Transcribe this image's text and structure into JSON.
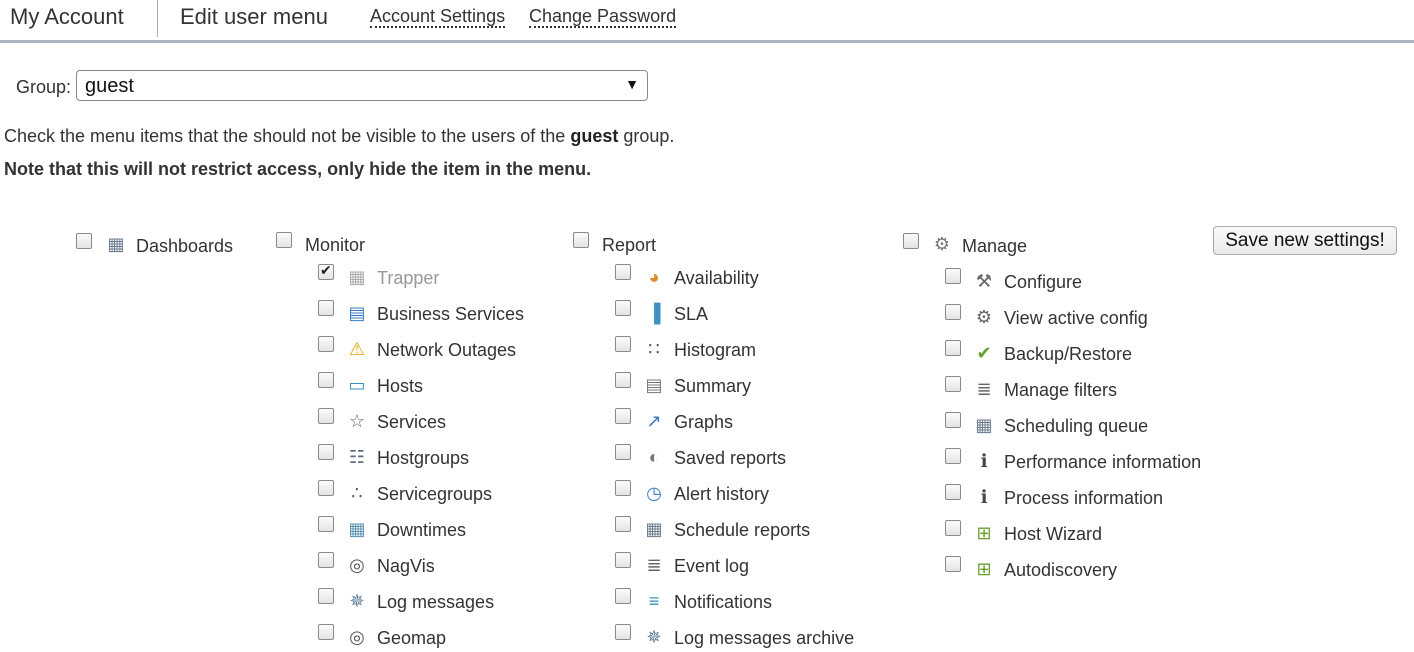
{
  "header": {
    "title": "My Account",
    "subtitle": "Edit user menu",
    "links": [
      "Account Settings",
      "Change Password"
    ]
  },
  "group": {
    "label": "Group:",
    "selected": "guest"
  },
  "info": {
    "pre": "Check the menu items that the should not be visible to the users of the ",
    "group": "guest",
    "post": " group.",
    "note": "Note that this will not restrict access, only hide the item in the menu."
  },
  "save_label": "Save new settings!",
  "sections": [
    {
      "label": "Dashboards",
      "icon": "dashboard-icon",
      "items": []
    },
    {
      "label": "Monitor",
      "icon": "",
      "items": [
        {
          "label": "Trapper",
          "icon": "trapper-icon",
          "checked": true
        },
        {
          "label": "Business Services",
          "icon": "business-services-icon",
          "checked": false
        },
        {
          "label": "Network Outages",
          "icon": "warning-icon",
          "checked": false
        },
        {
          "label": "Hosts",
          "icon": "monitor-icon",
          "checked": false
        },
        {
          "label": "Services",
          "icon": "star-icon",
          "checked": false
        },
        {
          "label": "Hostgroups",
          "icon": "hierarchy-icon",
          "checked": false
        },
        {
          "label": "Servicegroups",
          "icon": "servicegroup-icon",
          "checked": false
        },
        {
          "label": "Downtimes",
          "icon": "downtime-calendar-icon",
          "checked": false
        },
        {
          "label": "NagVis",
          "icon": "globe-icon",
          "checked": false
        },
        {
          "label": "Log messages",
          "icon": "log-icon",
          "checked": false
        },
        {
          "label": "Geomap",
          "icon": "globe-icon",
          "checked": false
        }
      ]
    },
    {
      "label": "Report",
      "icon": "",
      "items": [
        {
          "label": "Availability",
          "icon": "pie-chart-icon",
          "checked": false
        },
        {
          "label": "SLA",
          "icon": "bar-chart-icon",
          "checked": false
        },
        {
          "label": "Histogram",
          "icon": "histogram-icon",
          "checked": false
        },
        {
          "label": "Summary",
          "icon": "summary-icon",
          "checked": false
        },
        {
          "label": "Graphs",
          "icon": "line-graph-icon",
          "checked": false
        },
        {
          "label": "Saved reports",
          "icon": "saved-reports-icon",
          "checked": false
        },
        {
          "label": "Alert history",
          "icon": "alert-history-icon",
          "checked": false
        },
        {
          "label": "Schedule reports",
          "icon": "calendar-icon",
          "checked": false
        },
        {
          "label": "Event log",
          "icon": "document-icon",
          "checked": false
        },
        {
          "label": "Notifications",
          "icon": "notification-icon",
          "checked": false
        },
        {
          "label": "Log messages archive",
          "icon": "log-icon",
          "checked": false
        }
      ]
    },
    {
      "label": "Manage",
      "icon": "gear-icon",
      "items": [
        {
          "label": "Configure",
          "icon": "wrench-icon",
          "checked": false
        },
        {
          "label": "View active config",
          "icon": "gear-magnifier-icon",
          "checked": false
        },
        {
          "label": "Backup/Restore",
          "icon": "backup-icon",
          "checked": false
        },
        {
          "label": "Manage filters",
          "icon": "document-icon",
          "checked": false
        },
        {
          "label": "Scheduling queue",
          "icon": "calendar-icon",
          "checked": false
        },
        {
          "label": "Performance information",
          "icon": "info-icon",
          "checked": false
        },
        {
          "label": "Process information",
          "icon": "info-icon",
          "checked": false
        },
        {
          "label": "Host Wizard",
          "icon": "add-monitor-icon",
          "checked": false
        },
        {
          "label": "Autodiscovery",
          "icon": "add-monitor-icon",
          "checked": false
        }
      ]
    }
  ]
}
